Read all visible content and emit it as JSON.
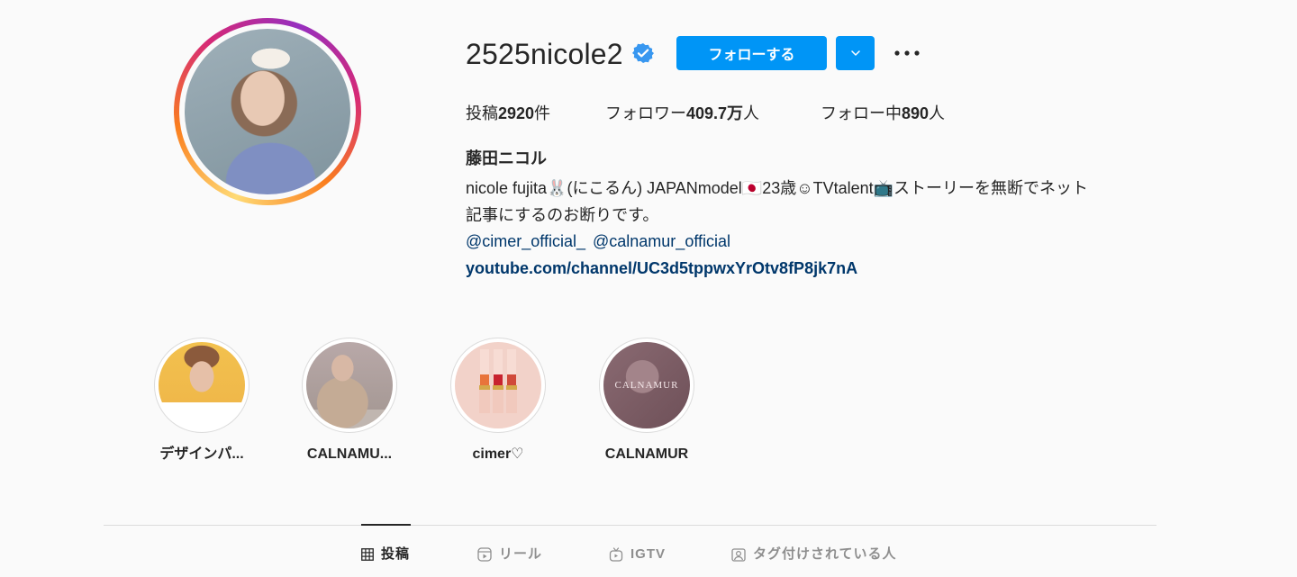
{
  "profile": {
    "username": "2525nicole2",
    "follow_label": "フォローする",
    "fullname": "藤田ニコル",
    "bio_line1": "nicole fujita🐰(にこるん) JAPANmodel🇯🇵23歳☺︎TVtalent📺ストーリーを無断でネット",
    "bio_line2": "記事にするのお断りです。",
    "mention1": "@cimer_official_",
    "mention2": "@calnamur_official",
    "link": "youtube.com/channel/UC3d5tppwxYrOtv8fP8jk7nA"
  },
  "stats": {
    "posts_label": "投稿",
    "posts_value": "2920",
    "posts_unit": "件",
    "followers_label": "フォロワー",
    "followers_value": "409.7万",
    "followers_unit": "人",
    "following_label": "フォロー中",
    "following_value": "890",
    "following_unit": "人"
  },
  "highlights": [
    {
      "label": "デザインパ..."
    },
    {
      "label": "CALNAMU..."
    },
    {
      "label": "cimer♡"
    },
    {
      "label": "CALNAMUR"
    }
  ],
  "highlight_overlay_text": "CALNAMUR",
  "tabs": [
    {
      "label": "投稿",
      "icon": "grid-icon"
    },
    {
      "label": "リール",
      "icon": "reels-icon"
    },
    {
      "label": "IGTV",
      "icon": "igtv-icon"
    },
    {
      "label": "タグ付けされている人",
      "icon": "tagged-icon"
    }
  ],
  "colors": {
    "accent": "#0095f6",
    "link": "#00376b",
    "verified": "#3897f0"
  }
}
